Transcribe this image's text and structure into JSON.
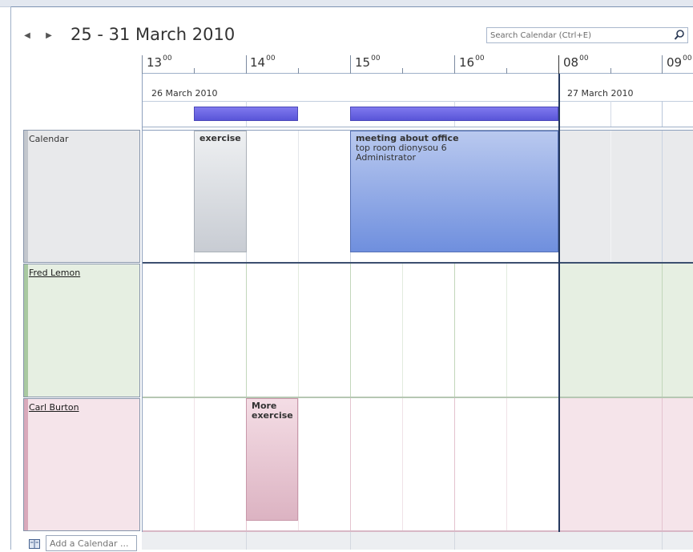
{
  "header": {
    "date_range": "25 - 31 March 2010",
    "search_placeholder": "Search Calendar (Ctrl+E)"
  },
  "timescale": {
    "hours": [
      {
        "hour": "13",
        "minutes": "00"
      },
      {
        "hour": "14",
        "minutes": "00"
      },
      {
        "hour": "15",
        "minutes": "00"
      },
      {
        "hour": "16",
        "minutes": "00"
      },
      {
        "hour": "08",
        "minutes": "00"
      },
      {
        "hour": "09",
        "minutes": "00"
      }
    ],
    "days": [
      "26 March 2010",
      "27 March 2010"
    ]
  },
  "rows": [
    {
      "label": "Calendar",
      "underlined": false
    },
    {
      "label": "Fred Lemon",
      "underlined": true
    },
    {
      "label": "Carl Burton",
      "underlined": true
    }
  ],
  "appointments": {
    "exercise": {
      "title": "exercise"
    },
    "meeting": {
      "title": "meeting about office",
      "location": "top room dionysou 6",
      "organizer": "Administrator"
    },
    "more_exercise": {
      "title": "More exercise"
    }
  },
  "footer": {
    "add_calendar_placeholder": "Add a Calendar ..."
  },
  "colors": {
    "calendar_row": "#e8eaed",
    "fred_row": "#e6efe2",
    "carl_row": "#f5e4ea",
    "busy_bar": "#6a66e4",
    "meeting_fill": "#8aa6e6"
  }
}
